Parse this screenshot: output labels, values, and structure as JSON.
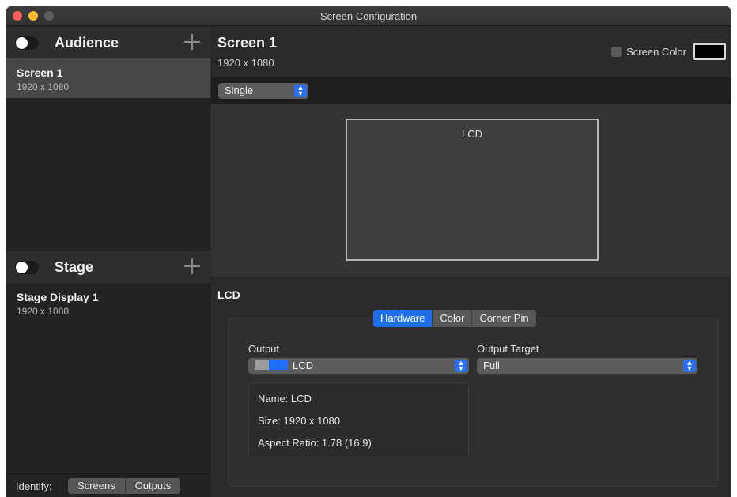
{
  "window": {
    "title": "Screen Configuration"
  },
  "sidebar": {
    "audience": {
      "title": "Audience",
      "items": [
        {
          "name": "Screen 1",
          "resolution": "1920 x 1080",
          "selected": true
        }
      ]
    },
    "stage": {
      "title": "Stage",
      "items": [
        {
          "name": "Stage Display 1",
          "resolution": "1920 x 1080",
          "selected": false
        }
      ]
    },
    "identify": {
      "label": "Identify:",
      "buttons": [
        "Screens",
        "Outputs"
      ]
    }
  },
  "main": {
    "title": "Screen 1",
    "resolution": "1920 x 1080",
    "screen_color": {
      "label": "Screen Color",
      "checked": false,
      "color": "#000000"
    },
    "layout_mode": "Single",
    "preview": {
      "label": "LCD"
    },
    "detail_title": "LCD",
    "tabs": [
      {
        "label": "Hardware",
        "active": true
      },
      {
        "label": "Color",
        "active": false
      },
      {
        "label": "Corner Pin",
        "active": false
      }
    ],
    "output": {
      "label": "Output",
      "value": "LCD"
    },
    "output_target": {
      "label": "Output Target",
      "value": "Full"
    },
    "info": {
      "name": "Name:  LCD",
      "size": "Size:  1920 x 1080",
      "aspect": "Aspect Ratio:  1.78 (16:9)"
    }
  },
  "colors": {
    "accent": "#1f6feb",
    "window_bg": "#2a2a2a",
    "sidebar_bg": "#232323"
  }
}
